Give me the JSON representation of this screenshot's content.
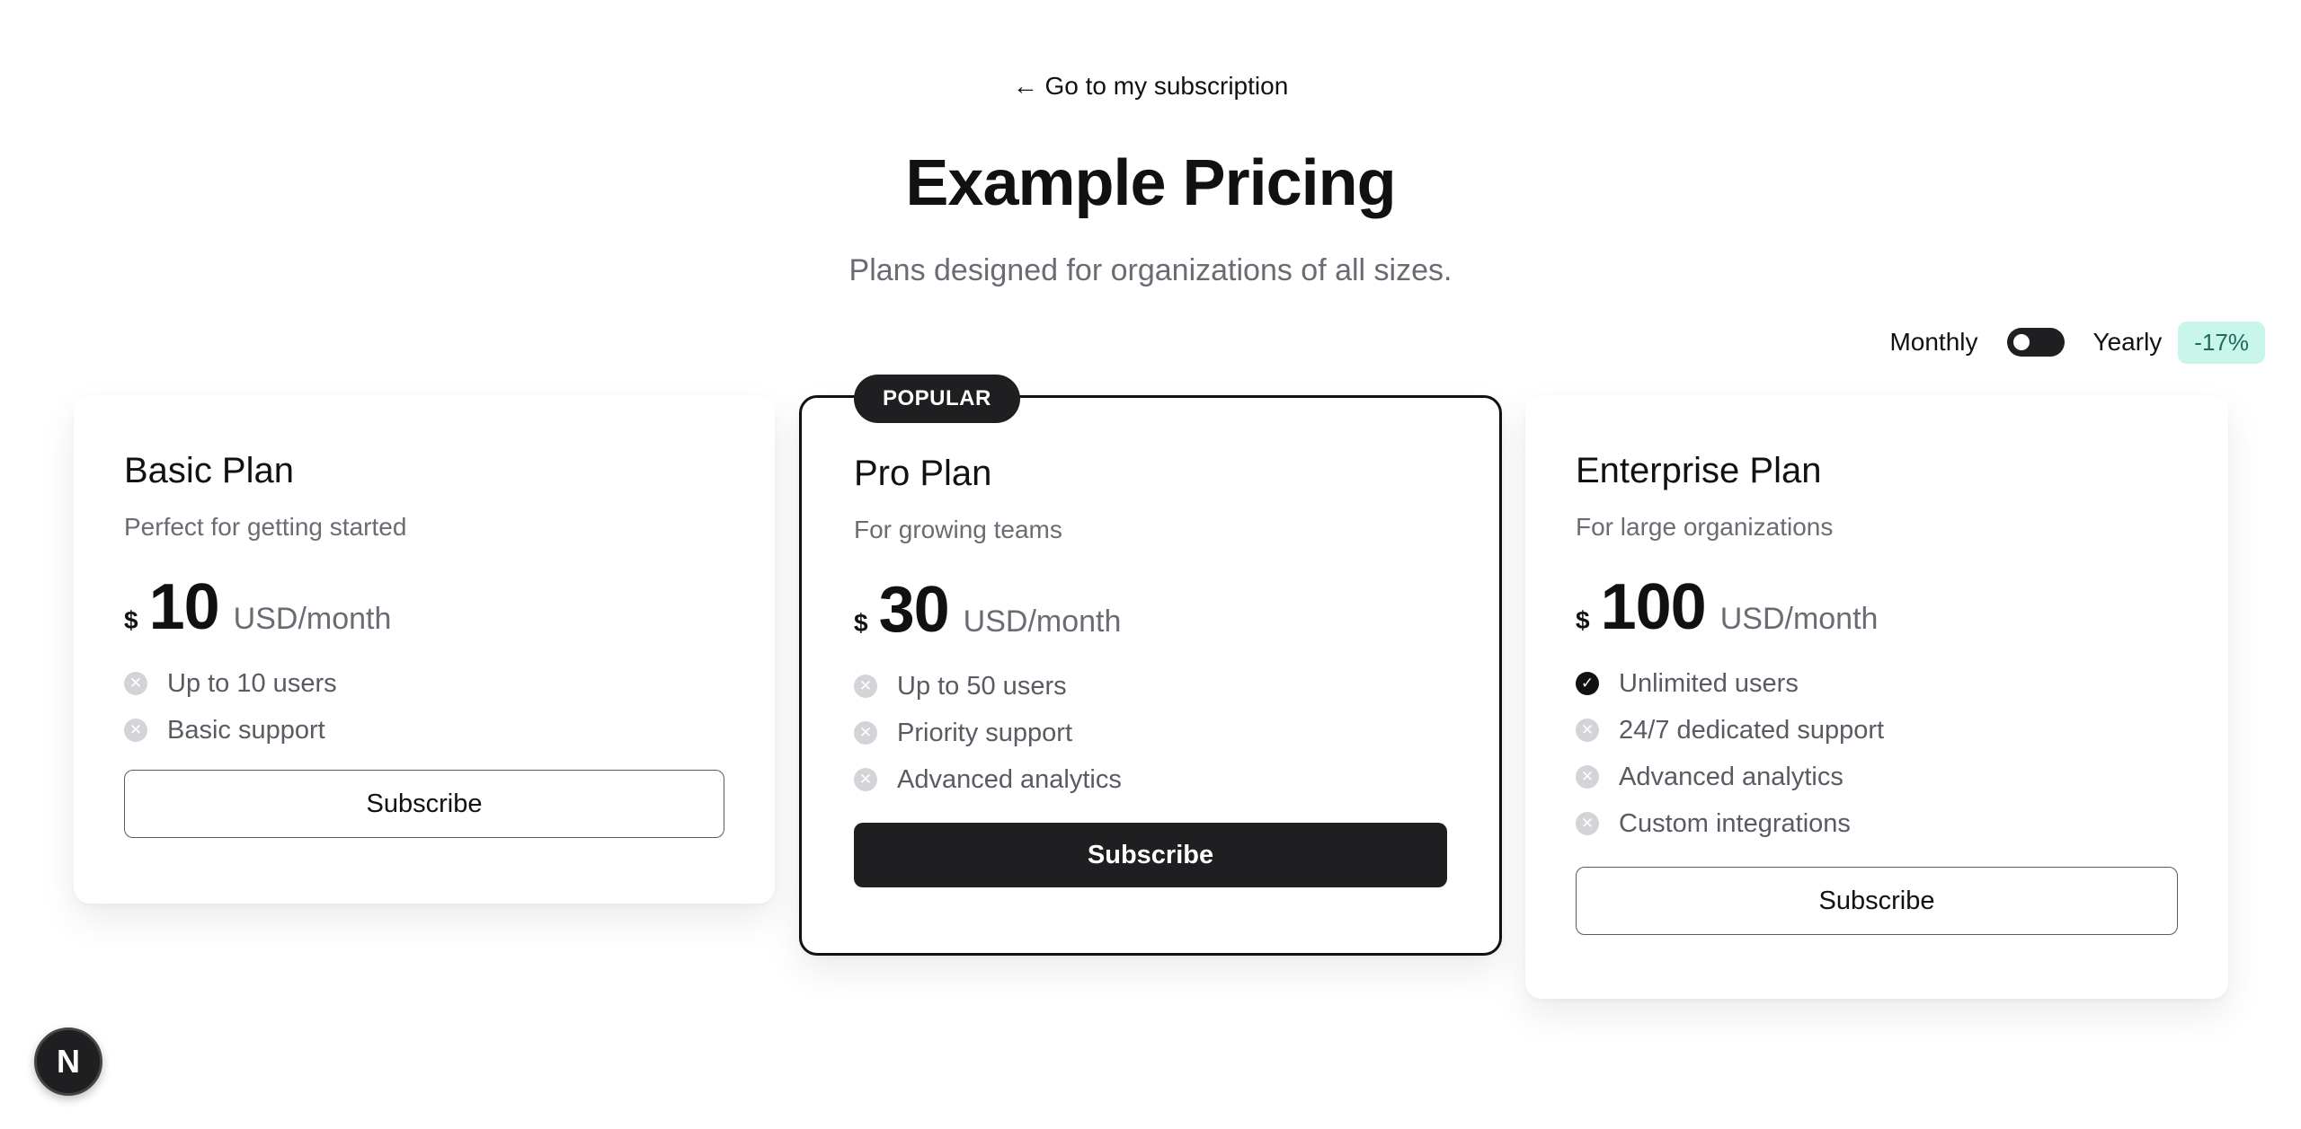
{
  "header": {
    "back_link": "← Go to my subscription",
    "title": "Example Pricing",
    "subtitle": "Plans designed for organizations of all sizes."
  },
  "billing": {
    "monthly_label": "Monthly",
    "yearly_label": "Yearly",
    "discount": "-17%",
    "toggle_state": "monthly"
  },
  "plans": [
    {
      "name": "Basic Plan",
      "description": "Perfect for getting started",
      "currency": "$",
      "price": "10",
      "period": "USD/month",
      "features": [
        {
          "text": "Up to 10 users",
          "icon": "x-circle-icon"
        },
        {
          "text": "Basic support",
          "icon": "x-circle-icon"
        }
      ],
      "button": "Subscribe"
    },
    {
      "name": "Pro Plan",
      "badge": "POPULAR",
      "description": "For growing teams",
      "currency": "$",
      "price": "30",
      "period": "USD/month",
      "features": [
        {
          "text": "Up to 50 users",
          "icon": "x-circle-icon"
        },
        {
          "text": "Priority support",
          "icon": "x-circle-icon"
        },
        {
          "text": "Advanced analytics",
          "icon": "x-circle-icon"
        }
      ],
      "button": "Subscribe"
    },
    {
      "name": "Enterprise Plan",
      "description": "For large organizations",
      "currency": "$",
      "price": "100",
      "period": "USD/month",
      "features": [
        {
          "text": "Unlimited users",
          "icon": "check-circle-icon"
        },
        {
          "text": "24/7 dedicated support",
          "icon": "x-circle-icon"
        },
        {
          "text": "Advanced analytics",
          "icon": "x-circle-icon"
        },
        {
          "text": "Custom integrations",
          "icon": "x-circle-icon"
        }
      ],
      "button": "Subscribe"
    }
  ],
  "dev_badge": "N",
  "colors": {
    "accent": "#1f1f21",
    "discount_bg": "#c9f5ea",
    "muted_text": "#6b6b73"
  }
}
